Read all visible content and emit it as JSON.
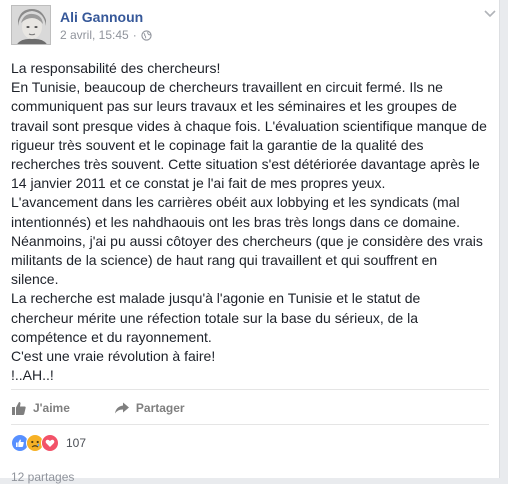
{
  "post": {
    "author": "Ali Gannoun",
    "timestamp": "2 avril, 15:45",
    "dot": "·",
    "privacy_icon": "globe-icon",
    "body_lines": [
      "La responsabilité des chercheurs!",
      "En Tunisie, beaucoup de chercheurs travaillent en circuit fermé. Ils ne",
      "communiquent pas sur leurs travaux et les séminaires et les groupes de",
      "travail sont presque vides à chaque fois. L'évaluation scientifique manque de",
      "rigueur très souvent et le copinage fait la garantie de la qualité des",
      "recherches très souvent. Cette situation s'est détériorée davantage après le",
      "14 janvier 2011 et ce constat je l'ai fait de mes propres yeux.",
      "L'avancement dans les carrières obéit aux lobbying et les syndicats (mal",
      "intentionnés) et les nahdhaouis ont les bras très longs dans ce domaine.",
      "Néanmoins, j'ai pu aussi côtoyer des chercheurs (que je considère des vrais",
      "militants de la science) de haut rang qui travaillent et qui souffrent en",
      "silence.",
      "La recherche est malade jusqu'à l'agonie en Tunisie et le statut de",
      "chercheur mérite une réfection totale sur la base du sérieux, de la",
      "compétence et du rayonnement.",
      "C'est une vraie révolution à faire!",
      "!..AH..!"
    ]
  },
  "actions": {
    "like_label": "J'aime",
    "share_label": "Partager"
  },
  "reactions": {
    "count": "107",
    "types": [
      "like",
      "sad",
      "love"
    ]
  },
  "shares": {
    "label": "12 partages"
  },
  "colors": {
    "author_link": "#365899",
    "meta_gray": "#90949c",
    "like_blue": "#5890ff",
    "sad_yellow": "#f7b125",
    "love_red": "#f25268"
  }
}
